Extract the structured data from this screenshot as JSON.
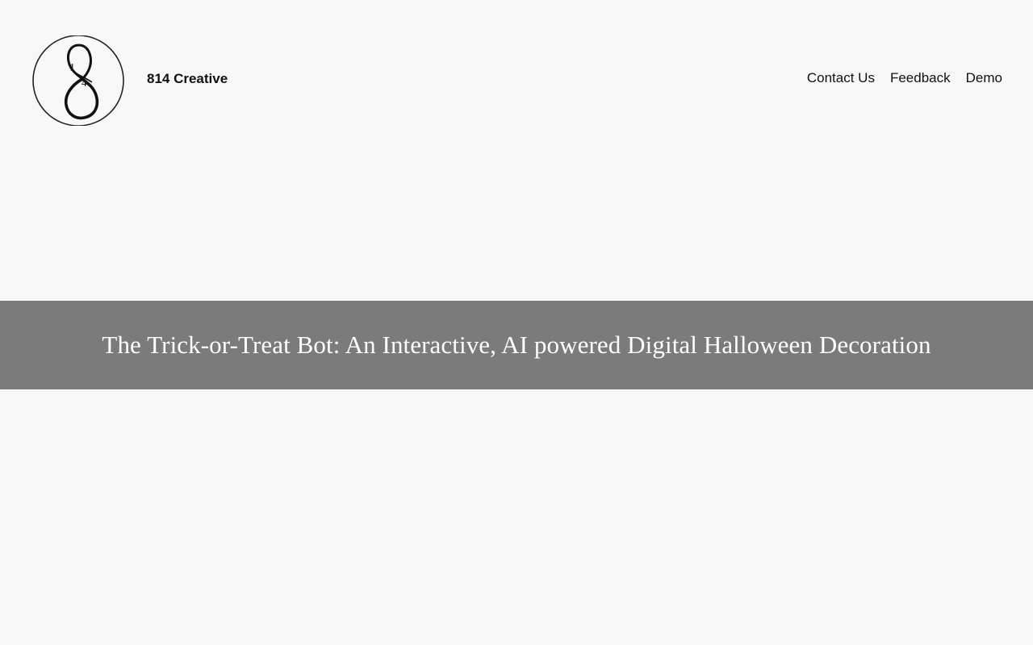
{
  "header": {
    "logo_icon": "814-monogram-logo",
    "logo_numerals": [
      "1",
      "4"
    ],
    "site_title": "814 Creative",
    "nav": [
      {
        "label": "Contact Us"
      },
      {
        "label": "Feedback"
      },
      {
        "label": "Demo"
      }
    ]
  },
  "hero": {
    "title": "The Trick-or-Treat Bot: An Interactive, AI powered Digital Halloween Decoration"
  },
  "colors": {
    "page_background": "#f8f8f8",
    "banner_background": "#7b7b7b",
    "banner_text": "#ffffff",
    "header_text": "#111111"
  }
}
